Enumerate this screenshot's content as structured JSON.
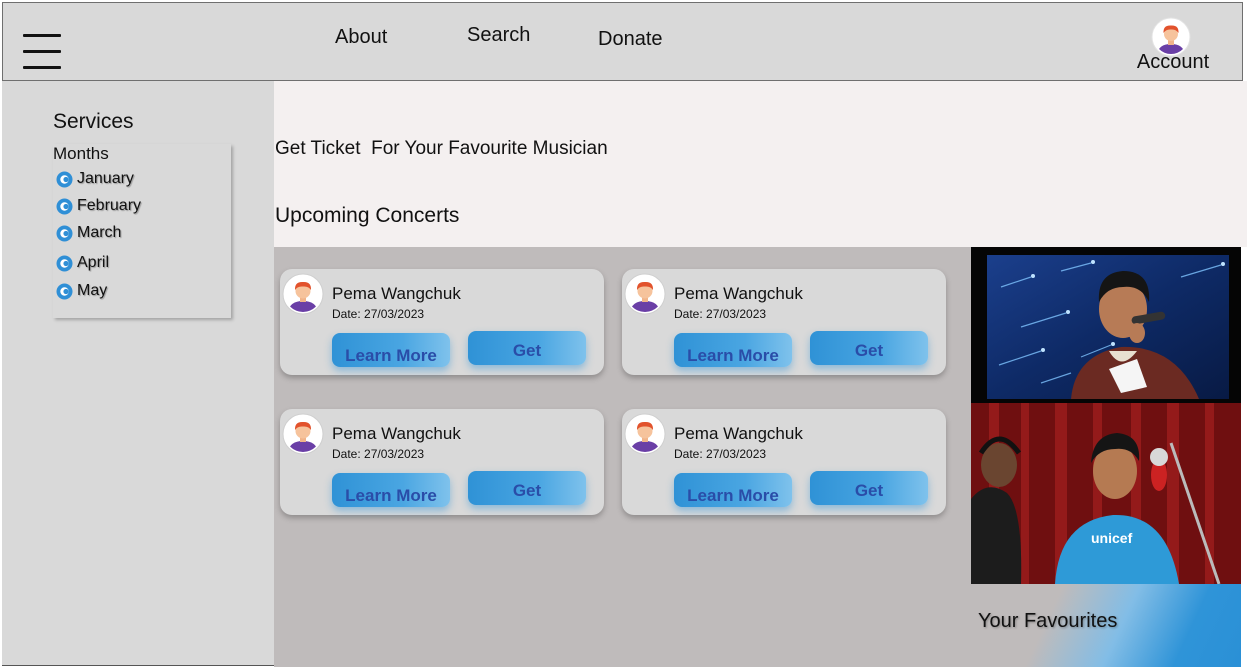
{
  "header": {
    "nav": [
      {
        "label": "About"
      },
      {
        "label": "Search"
      },
      {
        "label": "Donate"
      }
    ],
    "account_label": "Account"
  },
  "sidebar": {
    "title": "Services",
    "months_title": "Months",
    "months": [
      {
        "label": "January"
      },
      {
        "label": "February"
      },
      {
        "label": "March"
      },
      {
        "label": "April"
      },
      {
        "label": "May"
      }
    ]
  },
  "hero": {
    "tagline": "Get Ticket  For Your Favourite Musician",
    "heading": "Upcoming Concerts"
  },
  "concerts": [
    {
      "name": "Pema Wangchuk",
      "date": "Date: 27/03/2023",
      "learn_label": "Learn More",
      "get_label": "Get"
    },
    {
      "name": "Pema Wangchuk",
      "date": "Date: 27/03/2023",
      "learn_label": "Learn More",
      "get_label": "Get"
    },
    {
      "name": "Pema Wangchuk",
      "date": "Date: 27/03/2023",
      "learn_label": "Learn More",
      "get_label": "Get"
    },
    {
      "name": "Pema Wangchuk",
      "date": "Date: 27/03/2023",
      "learn_label": "Learn More",
      "get_label": "Get"
    }
  ],
  "favourites": {
    "label": "Your Favourites"
  },
  "colors": {
    "bar_bg": "#d9d9d9",
    "main_bg": "#bfbbbb",
    "hero_bg": "#f4f0f0",
    "button_blue": "#2f92d6",
    "button_text": "#2a4da8"
  },
  "icons": {
    "menu": "hamburger-icon",
    "avatar": "user-avatar-icon",
    "month_radio": "radio-icon"
  }
}
